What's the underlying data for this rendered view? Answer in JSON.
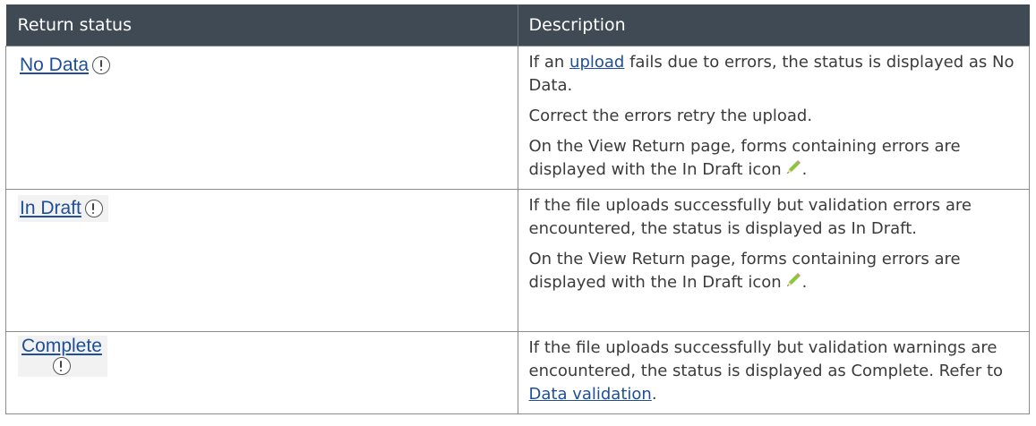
{
  "table": {
    "headers": {
      "status": "Return status",
      "description": "Description"
    },
    "rows": [
      {
        "status": "No Data",
        "paragraphs": {
          "p1_before": "If an ",
          "p1_link": "upload",
          "p1_after": " fails due to errors, the status is displayed as No Data.",
          "p2": "Correct the errors retry the upload.",
          "p3": "On the View Return page, forms containing errors are displayed with the In Draft icon",
          "p3_end": "."
        }
      },
      {
        "status": "In Draft",
        "paragraphs": {
          "p1": "If the file uploads successfully but validation errors are encountered, the status is displayed as In Draft.",
          "p2": "On the View Return page, forms containing errors are displayed with the In Draft icon",
          "p2_end": "."
        }
      },
      {
        "status": "Complete",
        "paragraphs": {
          "p1_before": "If the file uploads successfully but validation warnings are encountered, the status is displayed as Complete. Refer to ",
          "p1_link": "Data validation",
          "p1_after": "."
        }
      }
    ]
  },
  "icons": {
    "status_icon": "exclamation-circle-icon",
    "draft_icon": "pencil-icon"
  },
  "colors": {
    "header_bg": "#3f4a55",
    "link": "#1f4e9a",
    "pencil_body": "#8cc63f"
  }
}
